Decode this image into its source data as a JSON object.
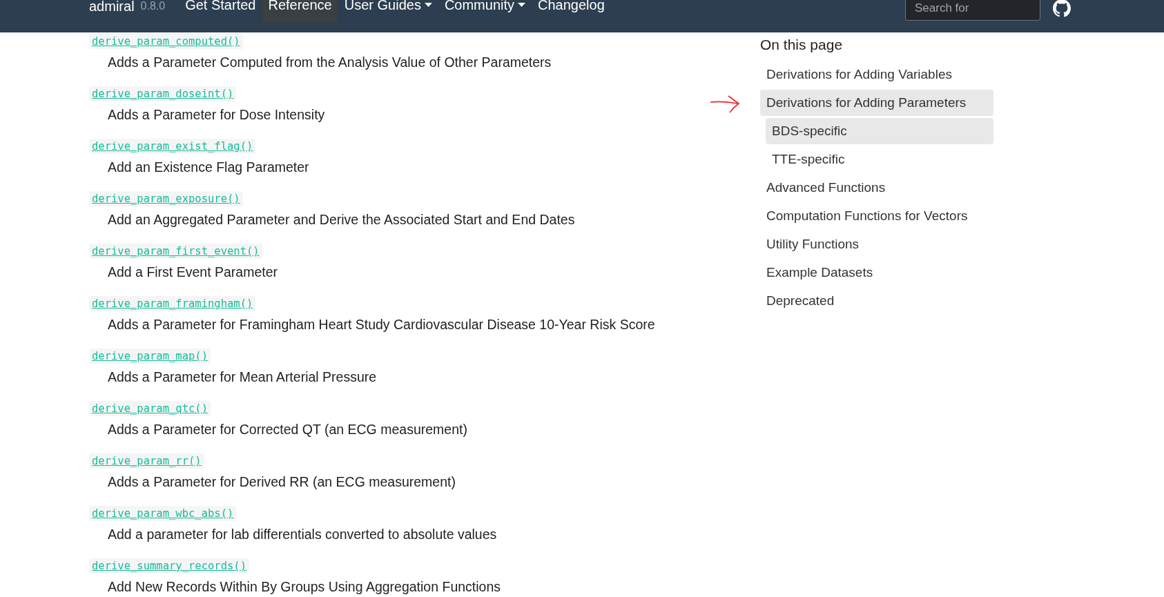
{
  "navbar": {
    "brand": "admiral",
    "version": "0.8.0",
    "links": [
      {
        "label": "Get Started",
        "selected": false,
        "dropdown": false
      },
      {
        "label": "Reference",
        "selected": true,
        "dropdown": false
      },
      {
        "label": "User Guides",
        "selected": false,
        "dropdown": true
      },
      {
        "label": "Community",
        "selected": false,
        "dropdown": true
      },
      {
        "label": "Changelog",
        "selected": false,
        "dropdown": false
      }
    ],
    "search": {
      "placeholder": "Search for"
    }
  },
  "functions": [
    {
      "name": "derive_param_computed()",
      "description": "Adds a Parameter Computed from the Analysis Value of Other Parameters"
    },
    {
      "name": "derive_param_doseint()",
      "description": "Adds a Parameter for Dose Intensity"
    },
    {
      "name": "derive_param_exist_flag()",
      "description": "Add an Existence Flag Parameter"
    },
    {
      "name": "derive_param_exposure()",
      "description": "Add an Aggregated Parameter and Derive the Associated Start and End Dates"
    },
    {
      "name": "derive_param_first_event()",
      "description": "Add a First Event Parameter"
    },
    {
      "name": "derive_param_framingham()",
      "description": "Adds a Parameter for Framingham Heart Study Cardiovascular Disease 10-Year Risk Score"
    },
    {
      "name": "derive_param_map()",
      "description": "Adds a Parameter for Mean Arterial Pressure"
    },
    {
      "name": "derive_param_qtc()",
      "description": "Adds a Parameter for Corrected QT (an ECG measurement)"
    },
    {
      "name": "derive_param_rr()",
      "description": "Adds a Parameter for Derived RR (an ECG measurement)"
    },
    {
      "name": "derive_param_wbc_abs()",
      "description": "Add a parameter for lab differentials converted to absolute values"
    },
    {
      "name": "derive_summary_records()",
      "description": "Add New Records Within By Groups Using Aggregation Functions"
    }
  ],
  "toc": {
    "title": "On this page",
    "items": [
      {
        "label": "Derivations for Adding Variables",
        "selected": false
      },
      {
        "label": "Derivations for Adding Parameters",
        "selected": true,
        "annotated": true,
        "children": [
          {
            "label": "BDS-specific",
            "selected": true
          },
          {
            "label": "TTE-specific",
            "selected": false
          }
        ]
      },
      {
        "label": "Advanced Functions",
        "selected": false
      },
      {
        "label": "Computation Functions for Vectors",
        "selected": false
      },
      {
        "label": "Utility Functions",
        "selected": false
      },
      {
        "label": "Example Datasets",
        "selected": false
      },
      {
        "label": "Deprecated",
        "selected": false
      }
    ]
  }
}
